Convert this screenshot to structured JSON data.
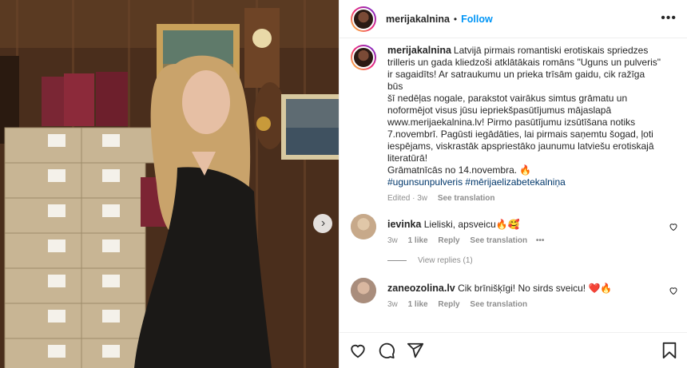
{
  "post": {
    "username": "merijakalnina",
    "follow_label": "Follow",
    "separator": "•",
    "more_label": "•••",
    "next_label": "›"
  },
  "caption": {
    "username": "merijakalnina",
    "lines": [
      "Latvijā pirmais romantiski erotiskais spriedzes",
      "trilleris un gada kliedzoši atklātākais romāns \"Uguns un pulveris\"",
      "ir sagaidīts! Ar satraukumu un prieka trīsām gaidu, cik ražīga būs",
      "šī nedēļas nogale, parakstot vairākus simtus grāmatu un",
      "noformējot visus jūsu iepriekšpasūtījumus mājaslapā",
      "www.merijaekalnina.lv! Pirmo pasūtījumu izsūtīšana notiks",
      "7.novembrī. Pagūsti iegādāties, lai pirmais saņemtu šogad, ļoti",
      "iespējams, viskrastāk apspriestāko jaunumu latviešu erotiskajā",
      "literatūrā!",
      "Grāmatnīcās no 14.novembra. 🔥"
    ],
    "hashtags": "#ugunsunpulveris #mērijaelizabetekalniņa",
    "time": "Edited · 3w",
    "translation": "See translation"
  },
  "comments": [
    {
      "username": "ievinka",
      "text": "Lieliski, apsveicu🔥🥰",
      "time": "3w",
      "likes": "1 like",
      "reply": "Reply",
      "translation": "See translation",
      "more": "•••"
    },
    {
      "username": "zaneozolina.lv",
      "text": "Cik brīnišķīgi! No sirds sveicu! ❤️🔥",
      "time": "3w",
      "likes": "1 like",
      "reply": "Reply",
      "translation": "See translation"
    }
  ],
  "view_replies": "View replies (1)",
  "icons": {
    "like": "heart-icon",
    "comment": "comment-icon",
    "share": "share-icon",
    "save": "bookmark-icon"
  },
  "colors": {
    "link": "#0095f6",
    "hashtag": "#00376b",
    "muted": "#8e8e8e"
  }
}
